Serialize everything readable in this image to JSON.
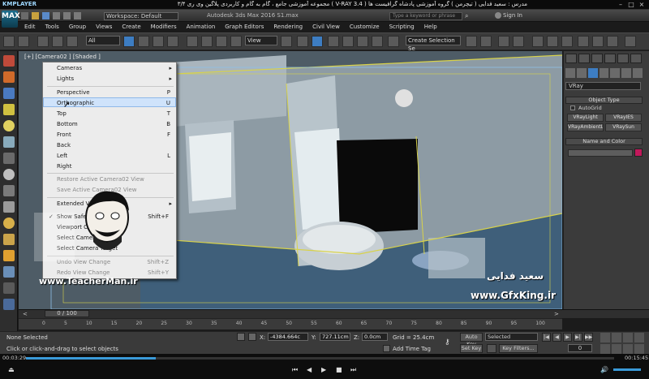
{
  "player": {
    "logo": "KMPLAYER",
    "title": "مجموعه آموزشی جامع ، گام به گام و کاربردی پلاگین وی ری ۳/۴  ( V-RAY 3.4 )  مدرس : سعید فدایی ( تیچرمن ) گروه آموزشی پادشاه گرافیست ها",
    "time_current": "00:03:29",
    "time_total": "00:15:45",
    "progress_fraction": 0.22
  },
  "titlebar": {
    "logo": "MAX",
    "workspace": "Workspace: Default",
    "app_title": "Autodesk 3ds Max 2016   S1.max",
    "search_placeholder": "Type a keyword or phrase",
    "signin": "Sign In"
  },
  "menubar": [
    "Edit",
    "Tools",
    "Group",
    "Views",
    "Create",
    "Modifiers",
    "Animation",
    "Graph Editors",
    "Rendering",
    "Civil View",
    "Customize",
    "Scripting",
    "Help"
  ],
  "toolbar": {
    "filter": "All",
    "ref_coord": "View",
    "selection_set": "Create Selection Se"
  },
  "viewport": {
    "label": "[+] [Camera02 ] [Shaded ]"
  },
  "context_menu": {
    "items": [
      {
        "label": "Cameras",
        "shortcut": "▸",
        "dim": false
      },
      {
        "label": "Lights",
        "shortcut": "▸",
        "dim": false
      },
      {
        "label": "Perspective",
        "shortcut": "P",
        "dim": false
      },
      {
        "label": "Orthographic",
        "shortcut": "U",
        "dim": false
      },
      {
        "label": "Top",
        "shortcut": "T",
        "dim": false
      },
      {
        "label": "Bottom",
        "shortcut": "B",
        "dim": false
      },
      {
        "label": "Front",
        "shortcut": "F",
        "dim": false
      },
      {
        "label": "Back",
        "shortcut": "",
        "dim": false
      },
      {
        "label": "Left",
        "shortcut": "L",
        "dim": false
      },
      {
        "label": "Right",
        "shortcut": "",
        "dim": false
      },
      {
        "label": "Restore Active Camera02 View",
        "shortcut": "",
        "dim": true
      },
      {
        "label": "Save Active Camera02 View",
        "shortcut": "",
        "dim": true
      },
      {
        "label": "Extended Viewports",
        "shortcut": "▸",
        "dim": false
      },
      {
        "label": "Show Safe Frames",
        "shortcut": "Shift+F",
        "dim": false
      },
      {
        "label": "Viewport Clipping",
        "shortcut": "",
        "dim": false
      },
      {
        "label": "Select Camera",
        "shortcut": "",
        "dim": false
      },
      {
        "label": "Select Camera Target",
        "shortcut": "",
        "dim": false
      },
      {
        "label": "Undo View Change",
        "shortcut": "Shift+Z",
        "dim": true
      },
      {
        "label": "Redo View Change",
        "shortcut": "Shift+Y",
        "dim": true
      }
    ]
  },
  "command_panel": {
    "renderer": "VRay",
    "object_type_title": "Object Type",
    "autogrid": "AutoGrid",
    "buttons": [
      "VRayLight",
      "VRayIES",
      "VRayAmbientLight",
      "VRaySun"
    ],
    "name_color_title": "Name and Color",
    "swatch_color": "#c2185b"
  },
  "timeline": {
    "frame": "0 / 100",
    "ticks": [
      "0",
      "5",
      "10",
      "15",
      "20",
      "25",
      "30",
      "35",
      "40",
      "45",
      "50",
      "55",
      "60",
      "65",
      "70",
      "75",
      "80",
      "85",
      "90",
      "95",
      "100"
    ]
  },
  "statusbar": {
    "selection": "None Selected",
    "hint": "Click or click-and-drag to select objects",
    "x_label": "X:",
    "x_value": "-4384.664c",
    "y_label": "Y:",
    "y_value": "727.11cm",
    "z_label": "Z:",
    "z_value": "0.0cm",
    "grid": "Grid = 25.4cm",
    "add_time_tag": "Add Time Tag",
    "auto_key": "Auto Key",
    "set_key": "Set Key",
    "selected": "Selected",
    "key_filters": "Key Filters...",
    "frame_field": "0"
  },
  "watermarks": {
    "teacherman": "www.TeacherMan.ir",
    "gfxking": "www.GfxKing.ir",
    "persian_name": "سعید فدایی"
  }
}
